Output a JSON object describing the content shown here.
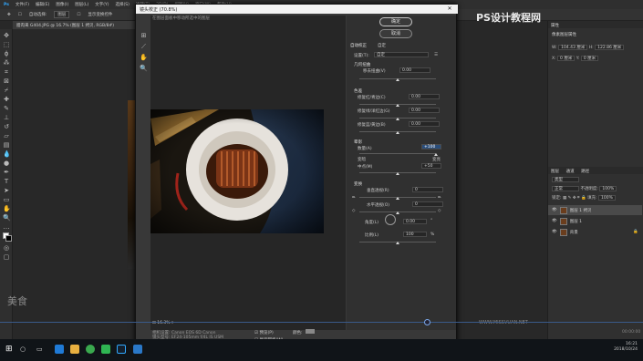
{
  "app": {
    "menu": [
      "文件(F)",
      "编辑(E)",
      "图像(I)",
      "图层(L)",
      "文字(Y)",
      "选择(S)",
      "滤镜(T)",
      "3D(D)",
      "视图(V)",
      "窗口(W)",
      "帮助(H)"
    ],
    "options": {
      "auto_select": "自动选择:",
      "group": "图层",
      "transform": "显示变换控件"
    },
    "doc_tab": "腊肉来 G404.JPG @ 16.7% (图层 1 拷贝, RGB/8#)",
    "watermark_left": "美食",
    "watermark_right": "PS设计教程网",
    "watermark_url": "WWW.MISSVUAN.NET"
  },
  "dialog": {
    "title": "镜头校正 (70.8%)",
    "close": "✕",
    "hint": "在图层面板中移动所选中的图层",
    "ok": "确定",
    "cancel": "取消",
    "tabs": {
      "auto": "自动校正",
      "custom": "自定"
    },
    "settings_label": "设置(T):",
    "settings_value": "自定",
    "geometric": {
      "title": "几何扭曲",
      "label": "移去扭曲(V)",
      "value": "0.00"
    },
    "chromatic": {
      "title": "色差",
      "items": [
        {
          "label": "修复红/青边(C)",
          "value": "0.00"
        },
        {
          "label": "修复绿/洋红边(G)",
          "value": "0.00"
        },
        {
          "label": "修复蓝/黄边(B)",
          "value": "0.00"
        }
      ]
    },
    "vignette": {
      "title": "晕影",
      "amount_label": "数量(A)",
      "amount_value": "+100",
      "darken": "变暗",
      "lighten": "变亮",
      "midpoint_label": "中点(M)",
      "midpoint_value": "+50"
    },
    "transform": {
      "title": "变换",
      "vertical_label": "垂直透视(R)",
      "vertical_value": "0",
      "horizontal_label": "水平透视(O)",
      "horizontal_value": "0",
      "angle_label": "角度(L)",
      "angle_value": "0.00",
      "scale_label": "比例(L)",
      "scale_value": "100",
      "scale_unit": "%"
    },
    "footer": {
      "zoom": "16.3%",
      "camera": "相机设置: Canon EOS 6D Canon",
      "lens": "镜头型号: EF24-105mm f/4L IS USM",
      "settings": "相机设置: 35 毫米, f/11, 1.60 秒",
      "preview": "预览(P)",
      "show_grid": "显示网格(W)",
      "color": "颜色:"
    }
  },
  "panels": {
    "properties_tab": "属性",
    "properties_title": "像素图层属性",
    "w_label": "W:",
    "w_value": "104.43 厘米",
    "h_label": "H:",
    "h_value": "122.86 厘米",
    "x_label": "X:",
    "x_value": "0 厘米",
    "y_label": "Y:",
    "y_value": "0 厘米",
    "layers_tabs": [
      "图层",
      "通道",
      "路径"
    ],
    "kind": "类型",
    "blend": "正常",
    "opacity_label": "不透明度:",
    "opacity_value": "100%",
    "lock_label": "锁定:",
    "fill_label": "填充:",
    "fill_value": "100%",
    "layers": [
      {
        "name": "图层 1 拷贝",
        "selected": true
      },
      {
        "name": "图层 1",
        "selected": false
      },
      {
        "name": "背景",
        "selected": false
      }
    ]
  },
  "timeline_end": "00:00:00",
  "taskbar": {
    "time": "16:21",
    "date": "2018/10/24"
  }
}
